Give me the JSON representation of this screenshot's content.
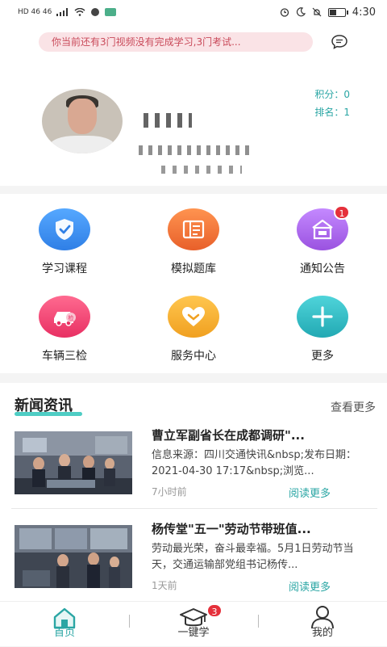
{
  "status_bar": {
    "left_text": "HD 46 46",
    "time": "4:30"
  },
  "notice": {
    "text": "你当前还有3门视频没有完成学习,3门考试..."
  },
  "profile": {
    "points_label": "积分：",
    "points_value": "0",
    "rank_label": "排名：",
    "rank_value": "1"
  },
  "grid": [
    {
      "label": "学习课程",
      "icon": "shield-check-icon",
      "color": "#3c8ef0"
    },
    {
      "label": "模拟题库",
      "icon": "question-bank-icon",
      "color": "#f07e35"
    },
    {
      "label": "通知公告",
      "icon": "notice-icon",
      "color": "#b06ee8",
      "badge": "1"
    },
    {
      "label": "车辆三检",
      "icon": "car-check-icon",
      "color": "#f0457a"
    },
    {
      "label": "服务中心",
      "icon": "heart-icon",
      "color": "#f5b335"
    },
    {
      "label": "更多",
      "icon": "plus-icon",
      "color": "#3cc0c8"
    }
  ],
  "news": {
    "title": "新闻资讯",
    "more": "查看更多",
    "items": [
      {
        "headline": "曹立军副省长在成都调研\"...",
        "desc": "信息来源：四川交通快讯&nbsp;发布日期：2021-04-30 17:17&nbsp;浏览...",
        "time": "7小时前",
        "read_more": "阅读更多"
      },
      {
        "headline": "杨传堂\"五一\"劳动节带班值...",
        "desc": "劳动最光荣，奋斗最幸福。5月1日劳动节当天，交通运输部党组书记杨传...",
        "time": "1天前",
        "read_more": "阅读更多"
      }
    ]
  },
  "tabbar": {
    "tabs": [
      {
        "label": "首页",
        "active": true
      },
      {
        "label": "一键学",
        "badge": "3"
      },
      {
        "label": "我的"
      }
    ]
  }
}
